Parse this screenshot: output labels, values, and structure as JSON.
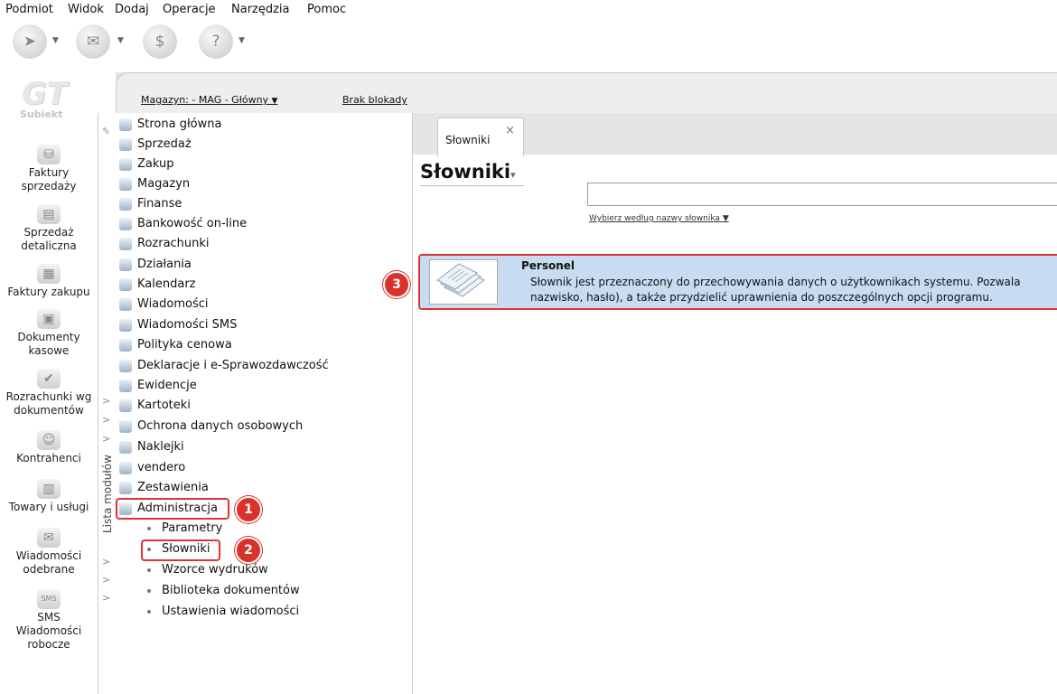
{
  "menu": [
    "Podmiot",
    "Widok",
    "Dodaj",
    "Operacje",
    "Narzędzia",
    "Pomoc"
  ],
  "logo": {
    "mark": "GT",
    "name": "Subiekt"
  },
  "sidebar": [
    {
      "label1": "Faktury",
      "label2": "sprzedaży"
    },
    {
      "label1": "Sprzedaż",
      "label2": "detaliczna"
    },
    {
      "label1": "Faktury zakupu",
      "label2": ""
    },
    {
      "label1": "Dokumenty",
      "label2": "kasowe"
    },
    {
      "label1": "Rozrachunki wg",
      "label2": "dokumentów"
    },
    {
      "label1": "Kontrahenci",
      "label2": ""
    },
    {
      "label1": "Towary i usługi",
      "label2": ""
    },
    {
      "label1": "Wiadomości",
      "label2": "odebrane"
    },
    {
      "label1": "SMS",
      "label2": "Wiadomości",
      "label3": "robocze",
      "badge": "SMS"
    }
  ],
  "strip": {
    "label": "Lista modułów"
  },
  "topbar": {
    "warehouse": "Magazyn: - MAG - Główny",
    "lock": "Brak blokady"
  },
  "modules": [
    "Strona główna",
    "Sprzedaż",
    "Zakup",
    "Magazyn",
    "Finanse",
    "Bankowość on-line",
    "Rozrachunki",
    "Działania",
    "Kalendarz",
    "Wiadomości",
    "Wiadomości SMS",
    "Polityka cenowa",
    "Deklaracje i e-Sprawozdawczość",
    "Ewidencje",
    "Kartoteki",
    "Ochrona danych osobowych",
    "Naklejki",
    "vendero",
    "Zestawienia",
    "Administracja"
  ],
  "submodules": [
    "Parametry",
    "Słowniki",
    "Wzorce wydruków",
    "Biblioteka dokumentów",
    "Ustawienia wiadomości"
  ],
  "badges": [
    "1",
    "2",
    "3"
  ],
  "tab": {
    "label": "Słowniki",
    "close": "×"
  },
  "page": {
    "title": "Słowniki",
    "filter": "Wybierz według nazwy słownika"
  },
  "card": {
    "title": "Personel",
    "desc1": "Słownik jest przeznaczony do przechowywania danych o użytkownikach systemu. Pozwala",
    "desc2": "nazwisko, hasło), a także przydzielić uprawnienia do poszczególnych opcji programu."
  },
  "colors": {
    "highlight": "#d33333",
    "badge": "#d9322a",
    "card": "#c7dcf0"
  }
}
